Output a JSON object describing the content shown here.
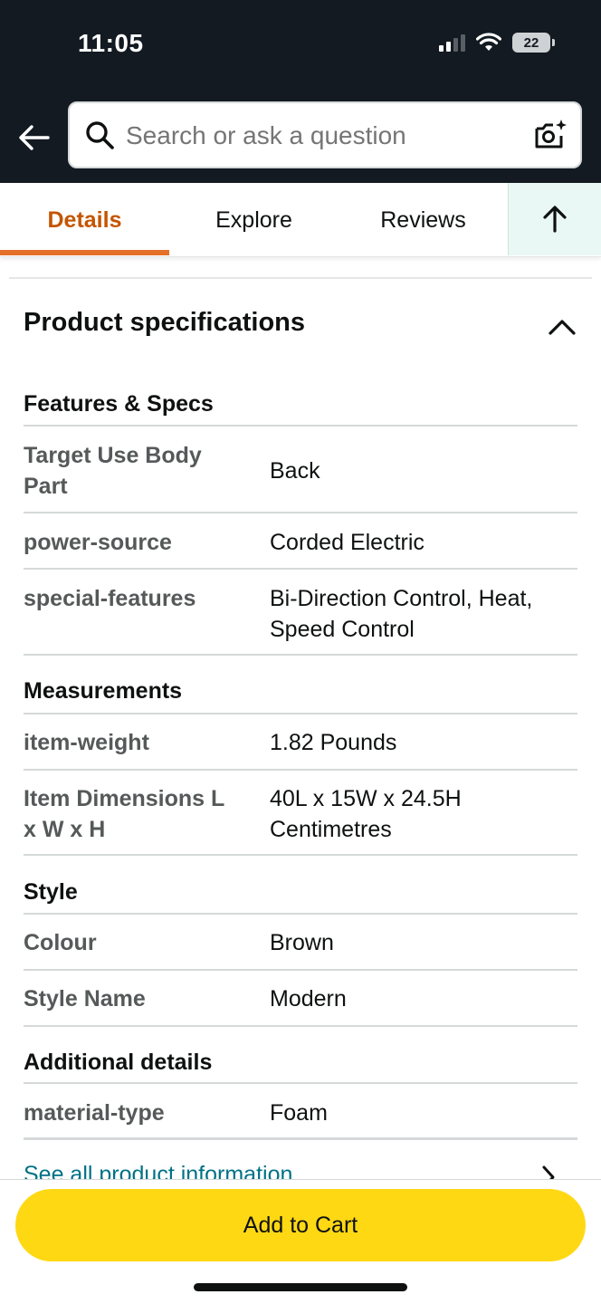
{
  "status_bar": {
    "time": "11:05",
    "battery": "22"
  },
  "search": {
    "placeholder": "Search or ask a question"
  },
  "tabs": [
    {
      "label": "Details",
      "active": true
    },
    {
      "label": "Explore",
      "active": false
    },
    {
      "label": "Reviews",
      "active": false
    }
  ],
  "icons": {
    "back": "arrow-left-icon",
    "search": "search-icon",
    "camera": "camera-icon",
    "scroll_top": "arrow-up-icon",
    "collapse": "chevron-up-icon",
    "see_all": "chevron-right-icon"
  },
  "colors": {
    "header_bg": "#131a22",
    "active_tab": "#c45500",
    "tab_underline": "#e5702a",
    "link": "#007185",
    "cart_button": "#ffd814"
  },
  "product_specifications": {
    "title": "Product specifications",
    "groups": [
      {
        "title": "Features & Specs",
        "rows": [
          {
            "label": "Target Use Body Part",
            "value": "Back"
          },
          {
            "label": "power-source",
            "value": "Corded Electric"
          },
          {
            "label": "special-features",
            "value": "Bi-Direction Control, Heat, Speed Control"
          }
        ]
      },
      {
        "title": "Measurements",
        "rows": [
          {
            "label": "item-weight",
            "value": "1.82 Pounds"
          },
          {
            "label": "Item Dimensions L x W x H",
            "value": "40L x 15W x 24.5H Centimetres"
          }
        ]
      },
      {
        "title": "Style",
        "rows": [
          {
            "label": "Colour",
            "value": "Brown"
          },
          {
            "label": "Style Name",
            "value": "Modern"
          }
        ]
      },
      {
        "title": "Additional details",
        "rows": [
          {
            "label": "material-type",
            "value": "Foam"
          }
        ]
      }
    ]
  },
  "see_all_link": "See all product information",
  "cart_button": "Add to Cart"
}
